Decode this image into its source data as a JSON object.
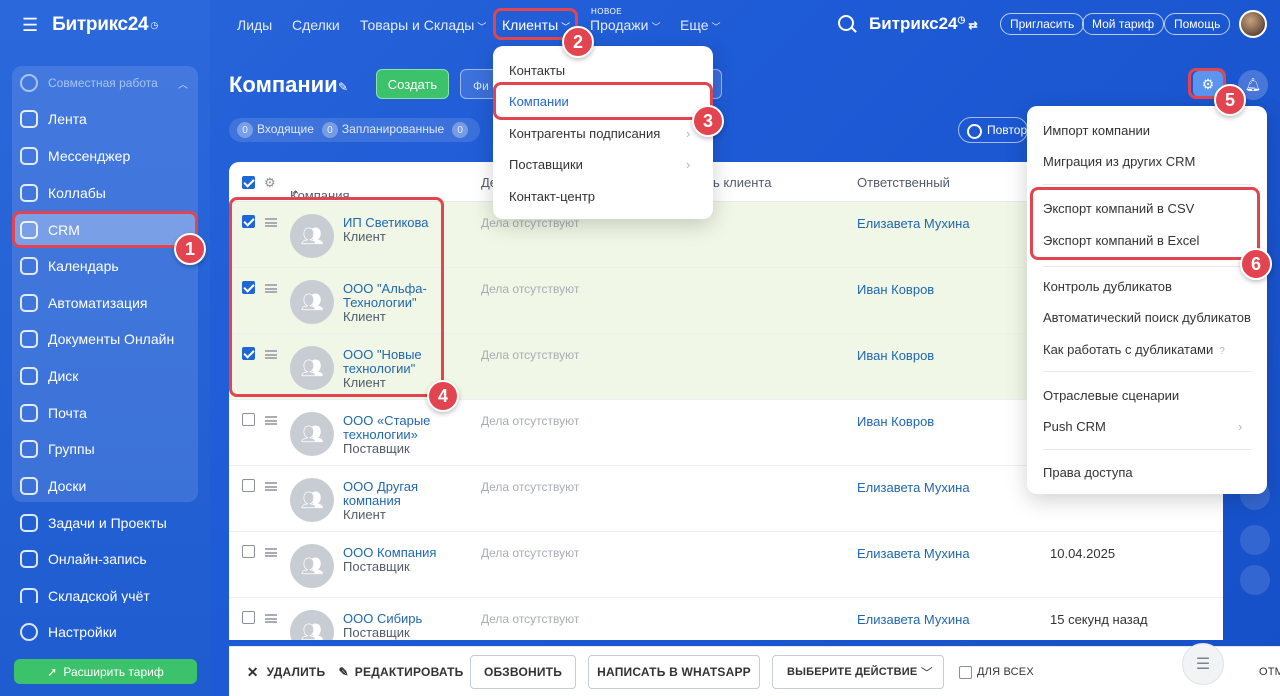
{
  "sidebar": {
    "logo": "Битрикс24",
    "group_label": "Совместная работа",
    "items": [
      {
        "label": "Лента",
        "icon": "feed-icon"
      },
      {
        "label": "Мессенджер",
        "icon": "chat-icon"
      },
      {
        "label": "Коллабы",
        "icon": "collab-icon"
      },
      {
        "label": "CRM",
        "icon": "crm-icon"
      },
      {
        "label": "Календарь",
        "icon": "calendar-icon"
      },
      {
        "label": "Автоматизация",
        "icon": "automation-icon"
      },
      {
        "label": "Документы Онлайн",
        "icon": "document-icon"
      },
      {
        "label": "Диск",
        "icon": "disk-icon"
      },
      {
        "label": "Почта",
        "icon": "mail-icon"
      },
      {
        "label": "Группы",
        "icon": "groups-icon"
      },
      {
        "label": "Доски",
        "icon": "boards-icon"
      }
    ],
    "outer_items": [
      {
        "label": "Задачи и Проекты",
        "icon": "tasks-icon"
      },
      {
        "label": "Онлайн-запись",
        "icon": "booking-icon"
      },
      {
        "label": "Складской учёт",
        "icon": "warehouse-icon"
      },
      {
        "label": "Настройки",
        "icon": "settings-icon"
      }
    ],
    "upgrade_label": "Расширить тариф"
  },
  "topnav": {
    "items": [
      "Лиды",
      "Сделки",
      "Товары и Склады",
      "Клиенты",
      "Продажи",
      "Еще"
    ],
    "new_tag": "НОВОЕ",
    "brand": "Битрикс24",
    "invite": "Пригласить",
    "tariff": "Мой тариф",
    "help": "Помощь"
  },
  "page": {
    "title": "Компании",
    "create_label": "Создать",
    "filter_placeholder": "Фи",
    "counters": [
      {
        "count": "0",
        "label": "Входящие"
      },
      {
        "count": "0",
        "label": "Запланированные"
      },
      {
        "count": "0",
        "label": ""
      }
    ],
    "repeat_label": "Повтор"
  },
  "grid": {
    "headers": {
      "company": "Компания",
      "deals": "Де",
      "client_mood": "ть клиента",
      "responsible": "Ответственный"
    },
    "rows": [
      {
        "name": "ИП Светикова",
        "type": "Клиент",
        "deals": "Дела отсутствуют",
        "responsible": "Елизавета Мухина",
        "date": "",
        "checked": true
      },
      {
        "name": "ООО \"Альфа-Технологии\"",
        "type": "Клиент",
        "deals": "Дела отсутствуют",
        "responsible": "Иван Ковров",
        "date": "",
        "checked": true
      },
      {
        "name": "ООО \"Новые технологии\"",
        "type": "Клиент",
        "deals": "Дела отсутствуют",
        "responsible": "Иван Ковров",
        "date": "",
        "checked": true
      },
      {
        "name": "ООО «Старые технологии»",
        "type": "Поставщик",
        "deals": "Дела отсутствуют",
        "responsible": "Иван Ковров",
        "date": "",
        "checked": false
      },
      {
        "name": "ООО Другая компания",
        "type": "Клиент",
        "deals": "Дела отсутствуют",
        "responsible": "Елизавета Мухина",
        "date": "",
        "checked": false
      },
      {
        "name": "ООО Компания",
        "type": "Поставщик",
        "deals": "Дела отсутствуют",
        "responsible": "Елизавета Мухина",
        "date": "10.04.2025",
        "checked": false
      },
      {
        "name": "ООО Сибирь",
        "type": "Поставщик",
        "deals": "Дела отсутствуют",
        "responsible": "Елизавета Мухина",
        "date": "15 секунд назад",
        "checked": false
      }
    ]
  },
  "bottom": {
    "delete": "УДАЛИТЬ",
    "edit": "РЕДАКТИРОВАТЬ",
    "call": "ОБЗВОНИТЬ",
    "whatsapp": "НАПИСАТЬ В WHATSAPP",
    "action": "ВЫБЕРИТЕ ДЕЙСТВИЕ",
    "for_all": "ДЛЯ ВСЕХ",
    "cancel": "ОТМ"
  },
  "clients_menu": {
    "items": [
      "Контакты",
      "Компании",
      "Контрагенты подписания",
      "Поставщики",
      "Контакт-центр"
    ]
  },
  "settings_menu": {
    "items": [
      "Импорт компании",
      "Миграция из других CRM",
      "Экспорт компаний в CSV",
      "Экспорт компаний в Excel",
      "Контроль дубликатов",
      "Автоматический поиск дубликатов",
      "Как работать с дубликатами",
      "Отраслевые сценарии",
      "Push CRM",
      "Права доступа"
    ]
  },
  "badges": [
    "1",
    "2",
    "3",
    "4",
    "5",
    "6"
  ],
  "colors": {
    "accent": "#2067d6",
    "highlight": "#e2454f",
    "create": "#3bc26a"
  }
}
